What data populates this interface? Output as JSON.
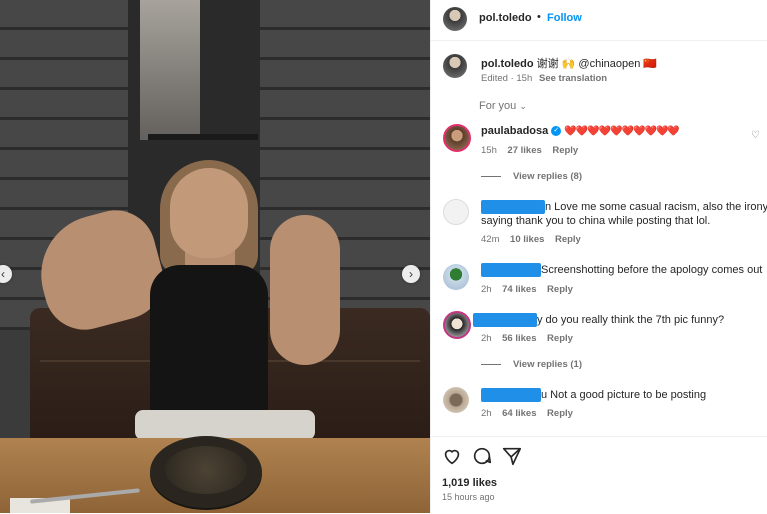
{
  "post": {
    "author": "pol.toledo",
    "follow_label": "Follow",
    "separator": "•",
    "caption": {
      "text": "谢谢 🙌 @chinaopen 🇨🇳",
      "edited": "Edited · 15h",
      "see_translation": "See translation"
    },
    "for_you_label": "For you"
  },
  "comments": [
    {
      "username": "paulabadosa",
      "verified": true,
      "text": "❤️❤️❤️❤️❤️❤️❤️❤️❤️❤️",
      "time": "15h",
      "likes": "27 likes",
      "reply": "Reply",
      "view_replies": "View replies (8)"
    },
    {
      "username": "",
      "redacted": true,
      "text_line1": "n Love me some casual racism, also the irony of",
      "text_line2": "saying thank you to china while posting that lol.",
      "time": "42m",
      "likes": "10 likes",
      "reply": "Reply"
    },
    {
      "username": "",
      "redacted": true,
      "text": "Screenshotting before the apology comes out",
      "time": "2h",
      "likes": "74 likes",
      "reply": "Reply"
    },
    {
      "username": "",
      "redacted": true,
      "text": "y do you really think the 7th pic funny?",
      "time": "2h",
      "likes": "56 likes",
      "reply": "Reply",
      "view_replies": "View replies (1)"
    },
    {
      "username": "",
      "redacted": true,
      "text": "u Not a good picture to be posting",
      "time": "2h",
      "likes": "64 likes",
      "reply": "Reply"
    }
  ],
  "footer": {
    "likes": "1,019 likes",
    "time_ago": "15 hours ago"
  },
  "icons": {
    "nav_left": "chevron-left-icon",
    "nav_right": "chevron-right-icon",
    "like": "heart-icon",
    "comment": "comment-icon",
    "share": "send-icon",
    "for_you_chevron": "chevron-down-icon"
  },
  "colors": {
    "accent": "#0095f6",
    "redaction": "#1f8fe8",
    "heart": "#e0245e"
  }
}
